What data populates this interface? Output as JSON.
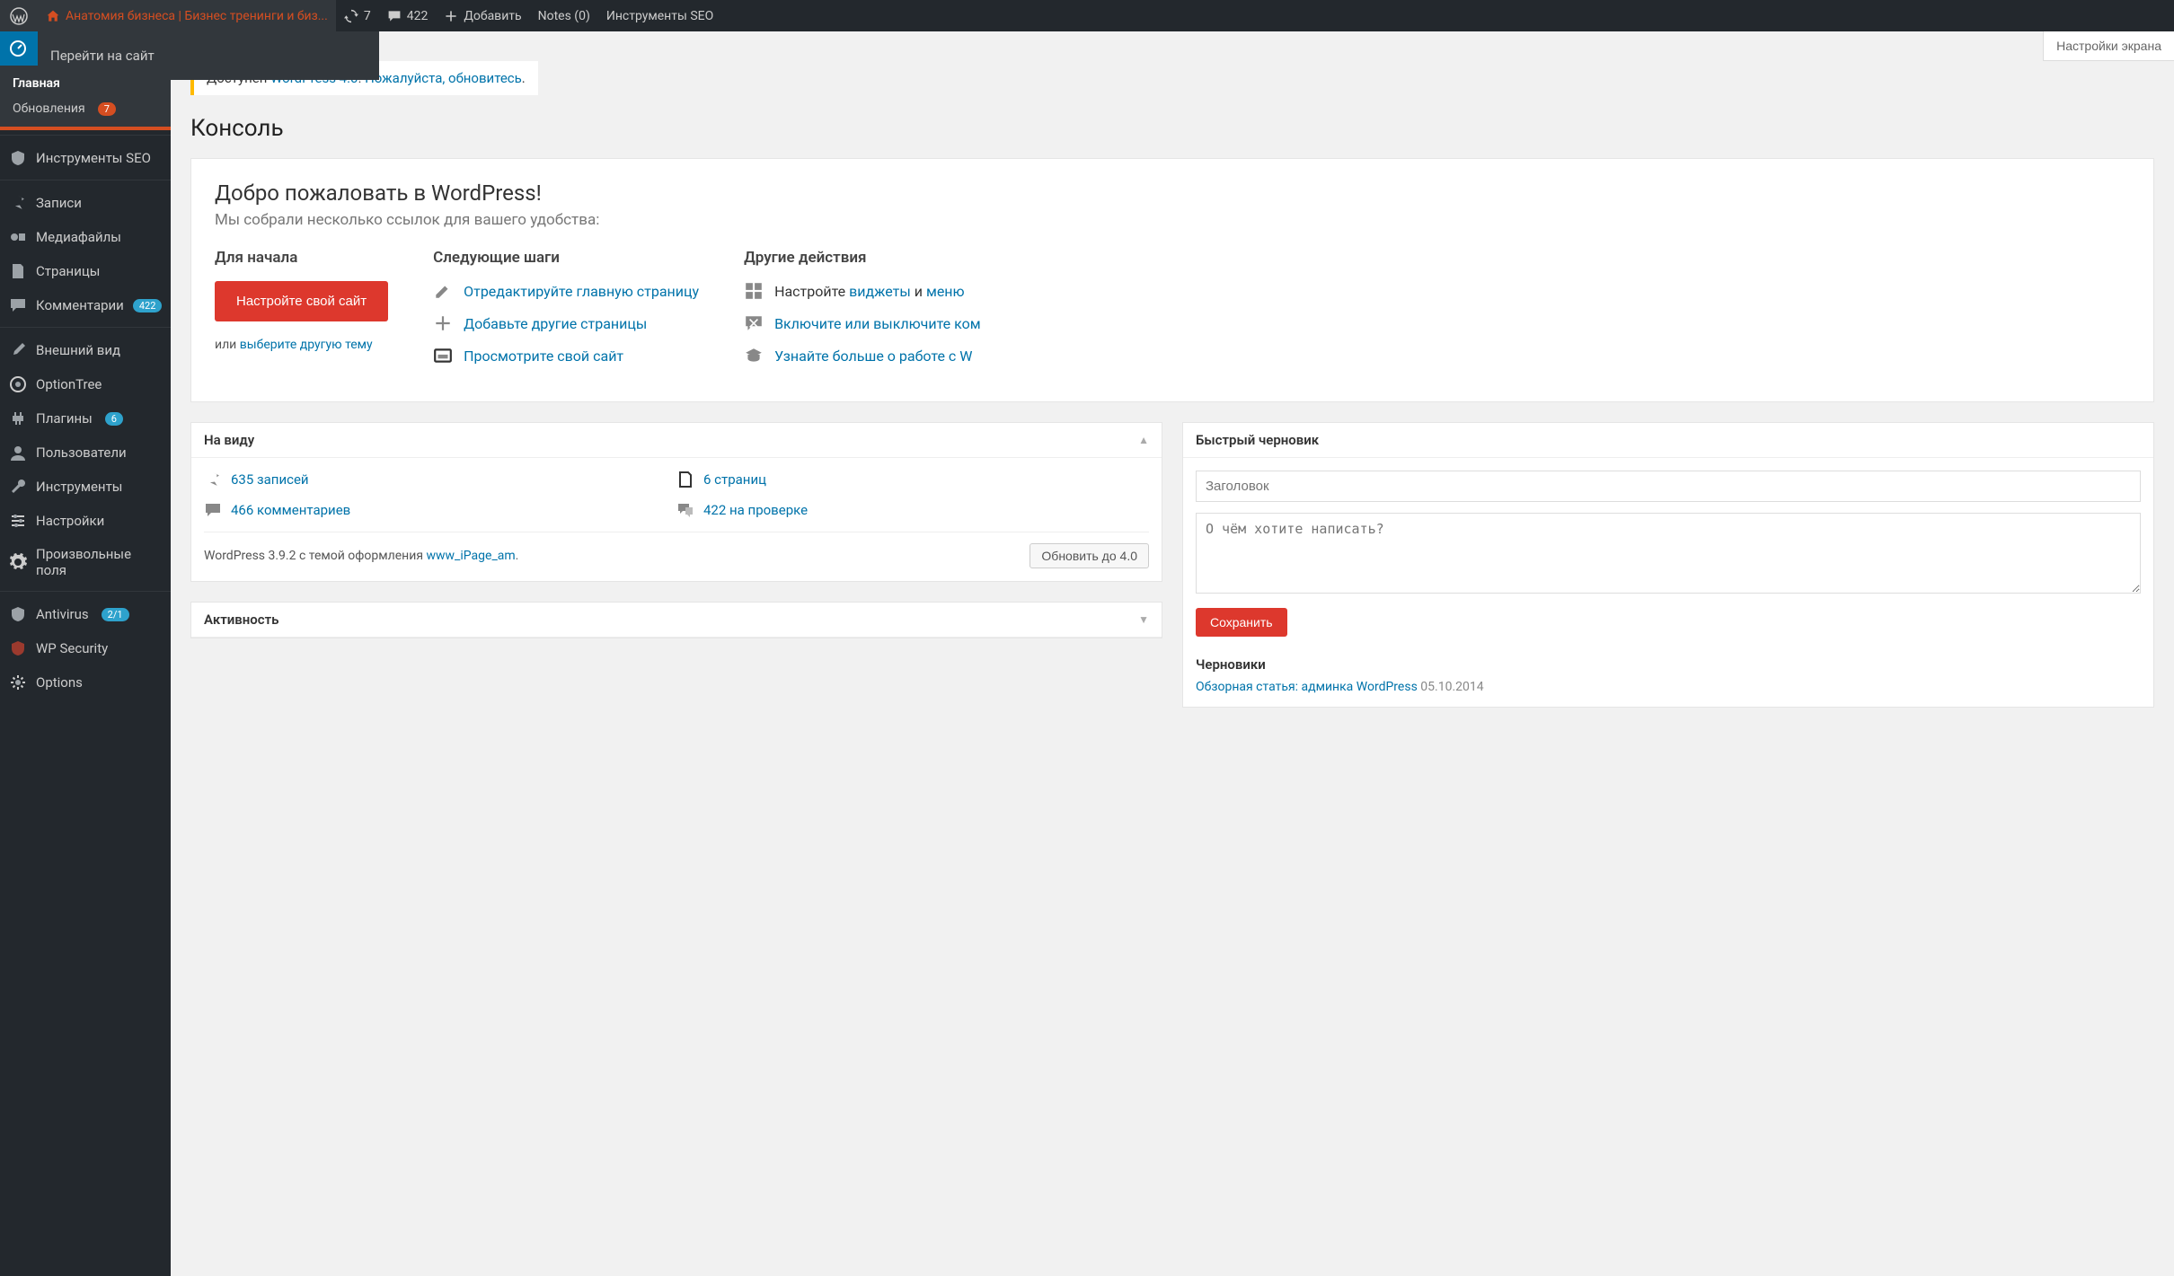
{
  "adminbar": {
    "site_name": "Анатомия бизнеса | Бизнес тренинги и биз...",
    "visit_site": "Перейти на сайт",
    "updates_count": "7",
    "comments_count": "422",
    "add_new": "Добавить",
    "notes": "Notes (0)",
    "seo_tools": "Инструменты SEO"
  },
  "screen_options": "Настройки экрана",
  "sidebar": {
    "dashboard": "Консоль",
    "dashboard_home": "Главная",
    "dashboard_updates": "Обновления",
    "dashboard_updates_count": "7",
    "seo": "Инструменты SEO",
    "posts": "Записи",
    "media": "Медиафайлы",
    "pages": "Страницы",
    "comments": "Комментарии",
    "comments_count": "422",
    "appearance": "Внешний вид",
    "optiontree": "OptionTree",
    "plugins": "Плагины",
    "plugins_count": "6",
    "users": "Пользователи",
    "tools": "Инструменты",
    "settings": "Настройки",
    "custom_fields": "Произвольные поля",
    "antivirus": "Antivirus",
    "antivirus_count": "2/1",
    "wpsecurity": "WP Security",
    "options": "Options"
  },
  "update_nag": {
    "pre": "Доступен ",
    "link1": "WordPress 4.0",
    "mid": "! ",
    "link2": "Пожалуйста, обновитесь",
    "post": "."
  },
  "page_title": "Консоль",
  "welcome": {
    "heading": "Добро пожаловать в WordPress!",
    "sub": "Мы собрали несколько ссылок для вашего удобства:",
    "col1_h": "Для начала",
    "col1_btn": "Настройте свой сайт",
    "col1_or_pre": "или ",
    "col1_or_link": "выберите другую тему",
    "col2_h": "Следующие шаги",
    "col2_items": [
      "Отредактируйте главную страницу",
      "Добавьте другие страницы",
      "Просмотрите свой сайт"
    ],
    "col3_h": "Другие действия",
    "col3_items": [
      {
        "pre": "Настройте ",
        "link1": "виджеты",
        "mid": " и ",
        "link2": "меню"
      },
      {
        "text": "Включите или выключите ком"
      },
      {
        "text": "Узнайте больше о работе с W"
      }
    ]
  },
  "glance": {
    "title": "На виду",
    "posts": "635 записей",
    "pages": "6 страниц",
    "comments": "466 комментариев",
    "moderation": "422 на проверке",
    "version_pre": "WordPress 3.9.2 с темой оформления ",
    "theme": "www_iPage_am",
    "version_post": ".",
    "update_btn": "Обновить до 4.0"
  },
  "activity": {
    "title": "Активность"
  },
  "quickdraft": {
    "title": "Быстрый черновик",
    "title_ph": "Заголовок",
    "content_ph": "О чём хотите написать?",
    "save": "Сохранить",
    "drafts_h": "Черновики",
    "draft1_title": "Обзорная статья: админка WordPress",
    "draft1_date": "05.10.2014"
  }
}
